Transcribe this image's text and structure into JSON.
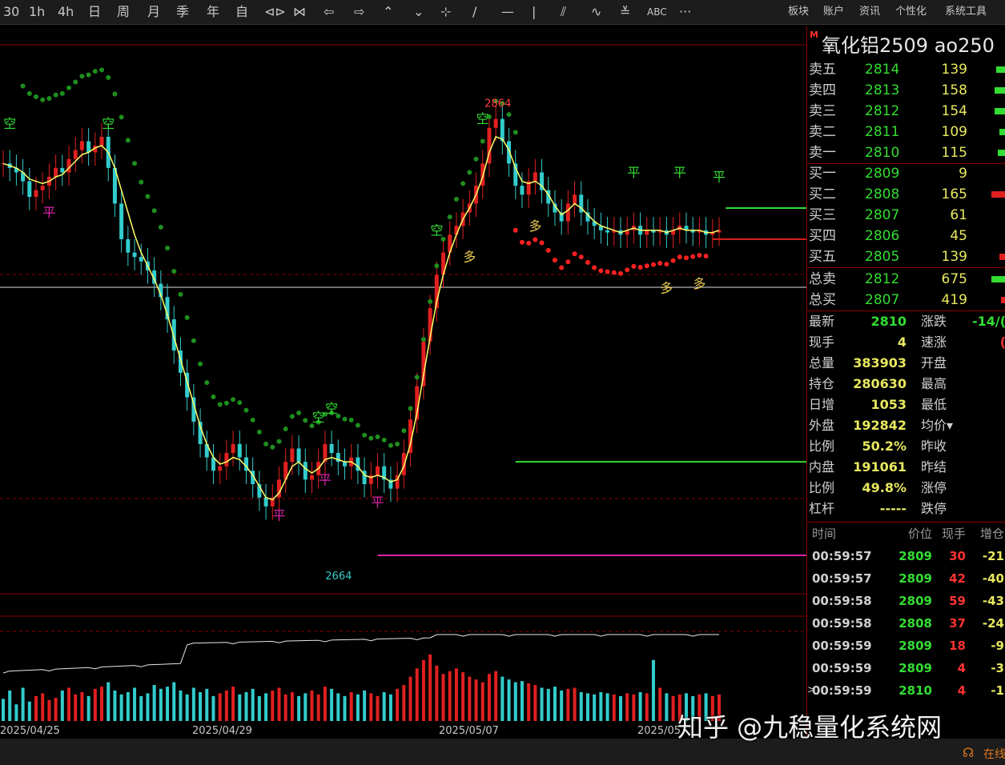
{
  "toolbar": {
    "left_items": [
      "30",
      "1h",
      "4h",
      "日",
      "周",
      "月",
      "季",
      "年",
      "自",
      "⊲⊳",
      "⋈",
      "⇦",
      "⇨",
      "⌃",
      "⌄",
      "⊹",
      "/",
      "—",
      "|",
      "⫽",
      "∿",
      "≚",
      "ABC",
      "···"
    ],
    "right_items": [
      "板块",
      "账户",
      "资讯",
      "个性化",
      "系统工具"
    ]
  },
  "symbol": {
    "marker": "M",
    "title": "氧化铝2509  ao250"
  },
  "orderbook": {
    "asks": [
      {
        "label": "卖五",
        "price": "2814",
        "volume": "139"
      },
      {
        "label": "卖四",
        "price": "2813",
        "volume": "158"
      },
      {
        "label": "卖三",
        "price": "2812",
        "volume": "154"
      },
      {
        "label": "卖二",
        "price": "2811",
        "volume": "109"
      },
      {
        "label": "卖一",
        "price": "2810",
        "volume": "115"
      }
    ],
    "bids": [
      {
        "label": "买一",
        "price": "2809",
        "volume": "9"
      },
      {
        "label": "买二",
        "price": "2808",
        "volume": "165"
      },
      {
        "label": "买三",
        "price": "2807",
        "volume": "61"
      },
      {
        "label": "买四",
        "price": "2806",
        "volume": "45"
      },
      {
        "label": "买五",
        "price": "2805",
        "volume": "139"
      }
    ],
    "totals": [
      {
        "label": "总卖",
        "price": "2812",
        "volume": "675"
      },
      {
        "label": "总买",
        "price": "2807",
        "volume": "419"
      }
    ]
  },
  "stats": [
    {
      "l1": "最新",
      "v1": "2810",
      "l2": "涨跌",
      "v2": "-14/("
    },
    {
      "l1": "现手",
      "v1": "4",
      "l2": "速涨",
      "v2": "("
    },
    {
      "l1": "总量",
      "v1": "383903",
      "l2": "开盘",
      "v2": ""
    },
    {
      "l1": "持仓",
      "v1": "280630",
      "l2": "最高",
      "v2": ""
    },
    {
      "l1": "日增",
      "v1": "1053",
      "l2": "最低",
      "v2": ""
    },
    {
      "l1": "外盘",
      "v1": "192842",
      "l2": "均价▾",
      "v2": ""
    },
    {
      "l1": "比例",
      "v1": "50.2%",
      "l2": "昨收",
      "v2": ""
    },
    {
      "l1": "内盘",
      "v1": "191061",
      "l2": "昨结",
      "v2": ""
    },
    {
      "l1": "比例",
      "v1": "49.8%",
      "l2": "涨停",
      "v2": ""
    },
    {
      "l1": "杠杆",
      "v1": "-----",
      "l2": "跌停",
      "v2": ""
    }
  ],
  "ticks": {
    "headers": [
      "时间",
      "价位",
      "现手",
      "增仓"
    ],
    "rows": [
      {
        "time": "00:59:57",
        "price": "2809",
        "hand": "30",
        "chg": "-21"
      },
      {
        "time": "00:59:57",
        "price": "2809",
        "hand": "42",
        "chg": "-40"
      },
      {
        "time": "00:59:58",
        "price": "2809",
        "hand": "59",
        "chg": "-43"
      },
      {
        "time": "00:59:58",
        "price": "2808",
        "hand": "37",
        "chg": "-24"
      },
      {
        "time": "00:59:59",
        "price": "2809",
        "hand": "18",
        "chg": "-9"
      },
      {
        "time": "00:59:59",
        "price": "2809",
        "hand": "4",
        "chg": "-3"
      },
      {
        "time": "00:59:59",
        "price": "2810",
        "hand": "4",
        "chg": "-1"
      }
    ],
    "pointer": ">"
  },
  "watermark": "知乎 @九稳量化系统网",
  "status_text": "在线",
  "colors": {
    "up": "#e02020",
    "down": "#33cccc",
    "ma": "#ffff66",
    "trail_bear": "#1f8f1f",
    "trail_bull": "#ff2020",
    "level_green": "#33dd33",
    "level_magenta": "#dd22aa",
    "level_red": "#e02020"
  },
  "chart_data": {
    "type": "candlestick",
    "series_summary": "30-minute K-line with trailing stop dots and volume",
    "price_labels": {
      "high": "2864",
      "low": "2664"
    },
    "x_ticks": [
      "2025/04/25",
      "2025/04/29",
      "2025/05/07",
      "2025/05"
    ],
    "signals": [
      {
        "text": "空",
        "type": "short",
        "index": 1
      },
      {
        "text": "空",
        "type": "short",
        "index": 16
      },
      {
        "text": "平",
        "type": "cover",
        "index": 7
      },
      {
        "text": "平",
        "type": "cover",
        "index": 42
      },
      {
        "text": "空",
        "type": "short",
        "index": 48
      },
      {
        "text": "空",
        "type": "short",
        "index": 50
      },
      {
        "text": "平",
        "type": "cover",
        "index": 49
      },
      {
        "text": "平",
        "type": "cover",
        "index": 57
      },
      {
        "text": "空",
        "type": "short",
        "index": 66
      },
      {
        "text": "空",
        "type": "short",
        "index": 73
      },
      {
        "text": "多",
        "type": "long",
        "index": 71
      },
      {
        "text": "多",
        "type": "long",
        "index": 81
      },
      {
        "text": "平",
        "type": "sell",
        "index": 96
      },
      {
        "text": "平",
        "type": "sell",
        "index": 103
      },
      {
        "text": "多",
        "type": "long",
        "index": 101
      },
      {
        "text": "平",
        "type": "sell",
        "index": 109
      },
      {
        "text": "多",
        "type": "long",
        "index": 106
      }
    ],
    "close": [
      2840,
      2838,
      2836,
      2832,
      2825,
      2828,
      2830,
      2834,
      2838,
      2836,
      2842,
      2846,
      2850,
      2845,
      2848,
      2852,
      2838,
      2822,
      2806,
      2800,
      2798,
      2796,
      2792,
      2786,
      2780,
      2770,
      2756,
      2746,
      2735,
      2724,
      2714,
      2708,
      2702,
      2704,
      2710,
      2714,
      2708,
      2702,
      2696,
      2690,
      2686,
      2690,
      2698,
      2706,
      2712,
      2706,
      2698,
      2700,
      2706,
      2714,
      2710,
      2706,
      2704,
      2708,
      2702,
      2696,
      2700,
      2704,
      2698,
      2694,
      2700,
      2710,
      2725,
      2740,
      2760,
      2775,
      2790,
      2800,
      2808,
      2812,
      2818,
      2822,
      2830,
      2840,
      2856,
      2860,
      2850,
      2840,
      2830,
      2826,
      2832,
      2836,
      2828,
      2822,
      2818,
      2814,
      2822,
      2826,
      2818,
      2814,
      2812,
      2810,
      2809,
      2810,
      2808,
      2810,
      2812,
      2808,
      2810,
      2809,
      2810,
      2808,
      2810,
      2812,
      2810,
      2809,
      2810,
      2808,
      2809,
      2810
    ],
    "ma": [
      2840,
      2839,
      2838,
      2836,
      2833,
      2832,
      2831,
      2832,
      2834,
      2835,
      2838,
      2841,
      2844,
      2845,
      2847,
      2848,
      2845,
      2838,
      2828,
      2818,
      2808,
      2800,
      2794,
      2788,
      2781,
      2772,
      2762,
      2752,
      2742,
      2732,
      2722,
      2714,
      2708,
      2705,
      2706,
      2708,
      2707,
      2704,
      2700,
      2695,
      2690,
      2689,
      2692,
      2698,
      2704,
      2706,
      2703,
      2701,
      2703,
      2707,
      2708,
      2707,
      2706,
      2706,
      2704,
      2700,
      2699,
      2700,
      2699,
      2697,
      2698,
      2704,
      2714,
      2728,
      2745,
      2762,
      2778,
      2790,
      2800,
      2808,
      2815,
      2820,
      2826,
      2834,
      2845,
      2852,
      2851,
      2846,
      2838,
      2832,
      2831,
      2832,
      2830,
      2826,
      2821,
      2817,
      2819,
      2822,
      2820,
      2817,
      2814,
      2812,
      2811,
      2810,
      2809,
      2810,
      2811,
      2810,
      2810,
      2810,
      2810,
      2809,
      2810,
      2811,
      2810,
      2810,
      2810,
      2809,
      2809,
      2810
    ],
    "volume": [
      40,
      55,
      30,
      60,
      35,
      45,
      50,
      38,
      42,
      55,
      60,
      48,
      52,
      45,
      58,
      62,
      70,
      55,
      48,
      52,
      60,
      45,
      50,
      65,
      58,
      62,
      70,
      55,
      48,
      60,
      52,
      58,
      45,
      50,
      55,
      62,
      48,
      52,
      58,
      45,
      50,
      55,
      60,
      48,
      52,
      45,
      50,
      55,
      48,
      62,
      58,
      50,
      45,
      52,
      48,
      55,
      50,
      45,
      52,
      48,
      58,
      65,
      80,
      95,
      110,
      120,
      100,
      85,
      90,
      95,
      88,
      80,
      75,
      70,
      85,
      90,
      80,
      75,
      70,
      72,
      68,
      65,
      60,
      58,
      62,
      55,
      58,
      60,
      52,
      50,
      48,
      52,
      50,
      48,
      45,
      50,
      48,
      52,
      50,
      110,
      60,
      50,
      45,
      48,
      50,
      45,
      48,
      50,
      45,
      48
    ],
    "open_interest_line": true,
    "levels": [
      {
        "name": "green-resistance",
        "price": 2706
      },
      {
        "name": "magenta-support",
        "price": 2664
      },
      {
        "name": "green-upper",
        "price": 2820
      },
      {
        "name": "red-lower",
        "price": 2806
      }
    ]
  }
}
